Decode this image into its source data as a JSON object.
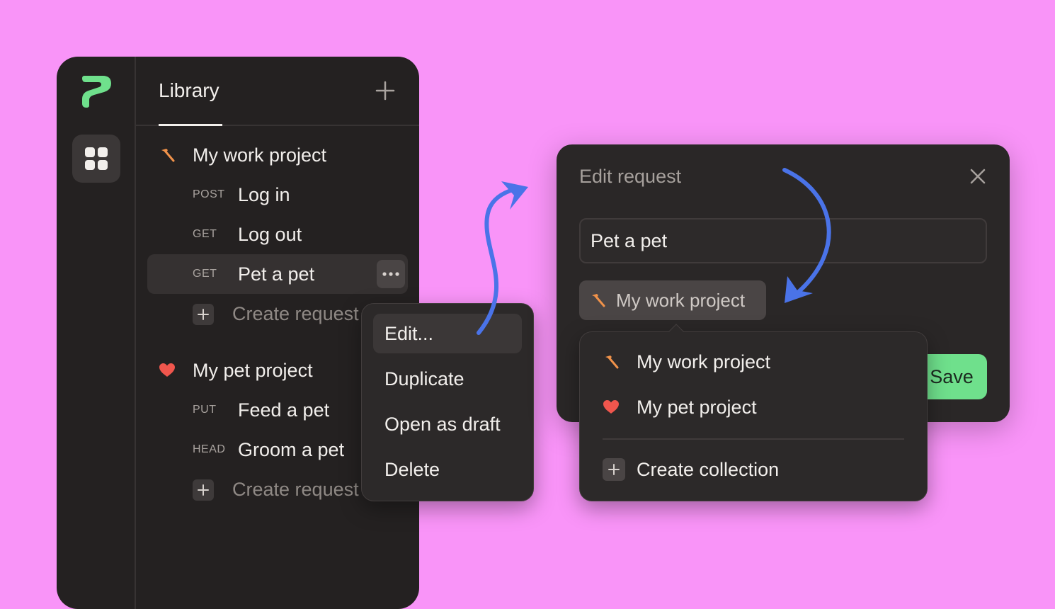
{
  "library": {
    "title": "Library",
    "collections": [
      {
        "name": "My work project",
        "icon": "hammer-icon",
        "requests": [
          {
            "method": "POST",
            "name": "Log in"
          },
          {
            "method": "GET",
            "name": "Log out"
          },
          {
            "method": "GET",
            "name": "Pet a pet"
          }
        ],
        "create_label": "Create request"
      },
      {
        "name": "My pet project",
        "icon": "heart-icon",
        "requests": [
          {
            "method": "PUT",
            "name": "Feed a pet"
          },
          {
            "method": "HEAD",
            "name": "Groom a pet"
          }
        ],
        "create_label": "Create request"
      }
    ]
  },
  "context_menu": {
    "items": [
      "Edit...",
      "Duplicate",
      "Open as draft",
      "Delete"
    ]
  },
  "edit_dialog": {
    "title": "Edit request",
    "name_value": "Pet a pet",
    "collection_label": "My work project",
    "save_label": "Save"
  },
  "collection_picker": {
    "items": [
      {
        "label": "My work project",
        "icon": "hammer-icon"
      },
      {
        "label": "My pet project",
        "icon": "heart-icon"
      }
    ],
    "create_label": "Create collection"
  },
  "colors": {
    "background": "#f994f8",
    "accent_green": "#6fe08c",
    "arrow_blue": "#4a73e8",
    "hammer_orange": "#f0924a",
    "heart_red": "#f0564d"
  }
}
